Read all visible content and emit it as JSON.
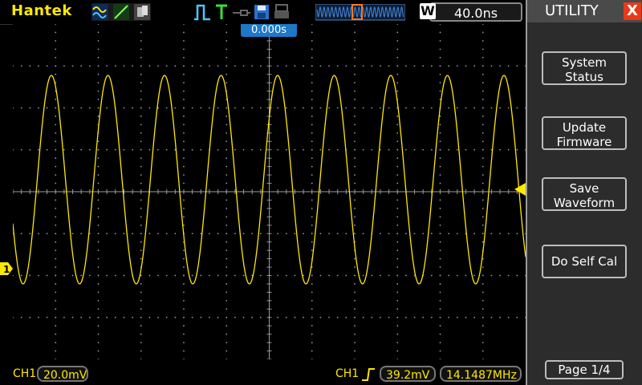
{
  "brand": "Hantek",
  "timebase": "40.0ns",
  "window_badge": "W",
  "trigger_position": "0.000s",
  "bottom": {
    "ch1_label": "CH1",
    "ch1_scale": "20.0mV",
    "trig_ch_label": "CH1",
    "trig_level": "39.2mV",
    "frequency": "14.1487MHz"
  },
  "menu": {
    "title": "UTILITY",
    "close_glyph": "X",
    "items": [
      {
        "line1": "System",
        "line2": "Status"
      },
      {
        "line1": "Update",
        "line2": "Firmware"
      },
      {
        "line1": "Save",
        "line2": "Waveform"
      },
      {
        "line1": "Do Self Cal",
        "line2": ""
      }
    ],
    "page": "Page 1/4"
  },
  "channel_marker": "1",
  "colors": {
    "trace": "#ffe800",
    "grid": "#9a9a9a",
    "accent": "#1e78c8",
    "close": "#e83a1a"
  },
  "icons": [
    "wave-mode-icon",
    "line-mode-icon",
    "persist-icon",
    "pulse-trigger-icon",
    "trigger-t-icon",
    "probe-icon",
    "save-disk-icon",
    "print-icon"
  ]
}
